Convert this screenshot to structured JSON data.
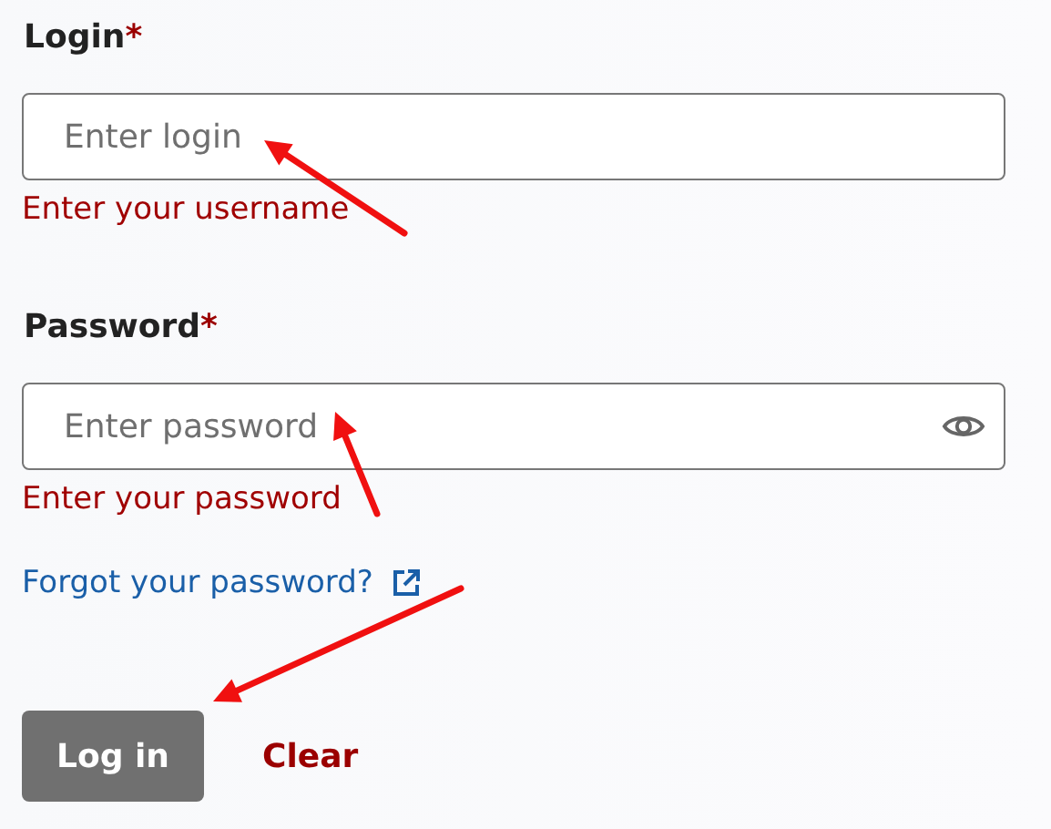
{
  "fields": [
    {
      "kind": "text",
      "label": "Login",
      "required_mark": "*",
      "placeholder": "Enter login",
      "error": "Enter your username"
    },
    {
      "kind": "password",
      "label": "Password",
      "required_mark": "*",
      "placeholder": "Enter password",
      "error": "Enter your password"
    }
  ],
  "forgot_link": "Forgot your password?",
  "buttons": [
    {
      "kind": "primary",
      "label": "Log in"
    },
    {
      "kind": "secondary",
      "label": "Clear"
    }
  ]
}
